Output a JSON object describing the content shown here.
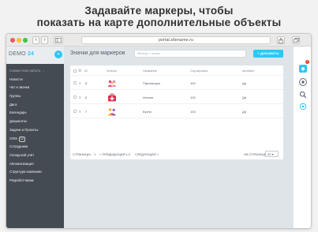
{
  "headline": {
    "line1": "Задавайте маркеры, чтобы",
    "line2": "показать на карте дополнительные  объекты"
  },
  "browser": {
    "back_icon": "chevron-left-icon",
    "forward_icon": "chevron-right-icon",
    "sidebar_icon": "sidebar-icon",
    "url": "portal.sitename.ru",
    "share_icon": "share-icon",
    "tabs_icon": "tabs-icon"
  },
  "sidebar": {
    "logo_text": "DEMO",
    "logo_number": "24",
    "collapse_icon": "double-chevron-left-icon",
    "items": [
      {
        "label": "Совместная работа →",
        "dim": true
      },
      {
        "label": "Новости"
      },
      {
        "label": "Чат и звонки"
      },
      {
        "label": "Группы"
      },
      {
        "label": "Диск"
      },
      {
        "label": "Календарь"
      },
      {
        "label": "Документы"
      },
      {
        "label": "Задачи и Проекты"
      },
      {
        "label": "CRM",
        "count": "12"
      },
      {
        "label": "Сотрудники"
      },
      {
        "label": "Складской учёт"
      },
      {
        "label": "Автоматизация"
      },
      {
        "label": "Структура компании"
      },
      {
        "label": "Разработчикам"
      }
    ]
  },
  "main": {
    "title": "Значки для маркеров",
    "filter_placeholder": "Фильтр + поиск",
    "add_button": "+ ДОБАВИТЬ",
    "columns": [
      "ID",
      "Значок",
      "Название",
      "Сортировка",
      "Активен"
    ],
    "rows": [
      {
        "id": "8",
        "icon": "people-pink-icon",
        "name": "Пиратворка",
        "sort": "100",
        "active": "Да"
      },
      {
        "id": "6",
        "icon": "first-aid-kit-icon",
        "name": "Аптека",
        "sort": "100",
        "active": "Да"
      },
      {
        "id": "7",
        "icon": "cooking-icon",
        "name": "Кухня",
        "sort": "100",
        "active": "Да"
      }
    ],
    "footer": {
      "pages": "СТРАНИЦЫ:",
      "page_num": "1",
      "prev": "< ПРЕДЫДУЩАЯ",
      "current": "1-3",
      "next": "СЛЕДУЮЩАЯ >",
      "per_page_label": "НА СТРАНИЦЕ:",
      "per_page": "20"
    }
  },
  "rightbar": {
    "icons": [
      "notifications-icon",
      "chat-icon",
      "search-icon",
      "settings-icon"
    ],
    "badge": "2"
  },
  "colors": {
    "accent": "#2fc6f6",
    "sidebar_bg": "#454b52",
    "workarea_bg": "#dfe4e8"
  }
}
